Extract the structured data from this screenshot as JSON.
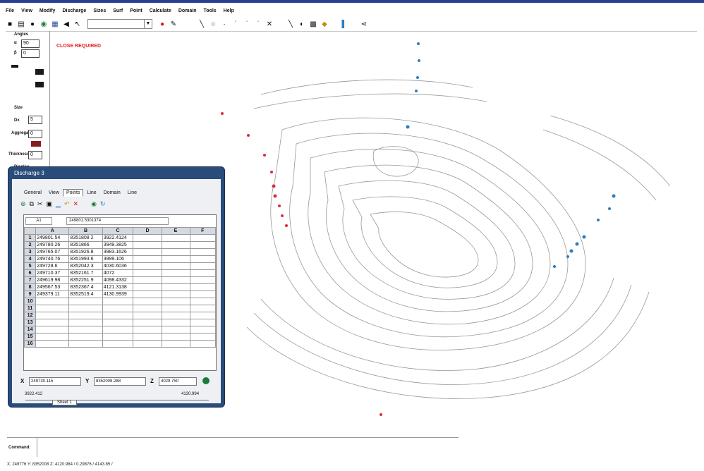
{
  "menu": [
    "File",
    "View",
    "Modify",
    "Discharge",
    "Sizes",
    "Surf",
    "Point",
    "Calculate",
    "Domain",
    "Tools",
    "Help"
  ],
  "toolbar": {
    "combo_value": ""
  },
  "left_panel": {
    "angles_label": "Angles",
    "a_value": "90",
    "b_value": "0",
    "size_label": "Size",
    "display_label": "Display",
    "dx_value": "5",
    "thickness_value": "0",
    "aggregate_value": "0"
  },
  "canvas": {
    "status_text": "CLOSE REQUIRED"
  },
  "dialog": {
    "title": "Discharge 3",
    "tabs": [
      "General",
      "View",
      "Points",
      "Line",
      "Domain",
      "Line"
    ],
    "active_tab": 2,
    "cell_ref": "A1",
    "formula": "249801.5301374",
    "columns": [
      "A",
      "B",
      "C",
      "D",
      "E",
      "F"
    ],
    "rows": [
      {
        "n": "1",
        "a": "249801.54",
        "b": "8351808 2",
        "c": "3922.4124"
      },
      {
        "n": "2",
        "a": "249780.26",
        "b": "8351866",
        "c": "3949.3825"
      },
      {
        "n": "3",
        "a": "249765.07",
        "b": "8351926.8",
        "c": "3983.1626"
      },
      {
        "n": "4",
        "a": "249740.76",
        "b": "8351993.6",
        "c": "3999.106"
      },
      {
        "n": "5",
        "a": "249728.6",
        "b": "8352042.3",
        "c": "4030.6036"
      },
      {
        "n": "6",
        "a": "249710.37",
        "b": "8352161.7",
        "c": "4072"
      },
      {
        "n": "7",
        "a": "249619.98",
        "b": "8352251.9",
        "c": "4098.4332"
      },
      {
        "n": "8",
        "a": "249567.53",
        "b": "8352367.4",
        "c": "4121.3138"
      },
      {
        "n": "9",
        "a": "249379.11",
        "b": "8352519.4",
        "c": "4130.9939"
      },
      {
        "n": "10",
        "a": "",
        "b": "",
        "c": ""
      },
      {
        "n": "11",
        "a": "",
        "b": "",
        "c": ""
      },
      {
        "n": "12",
        "a": "",
        "b": "",
        "c": ""
      },
      {
        "n": "13",
        "a": "",
        "b": "",
        "c": ""
      },
      {
        "n": "14",
        "a": "",
        "b": "",
        "c": ""
      },
      {
        "n": "15",
        "a": "",
        "b": "",
        "c": ""
      },
      {
        "n": "16",
        "a": "",
        "b": "",
        "c": ""
      }
    ],
    "sheet_tab": "Sheet 1",
    "x_label": "X",
    "x_value": "249730.115",
    "y_label": "Y",
    "y_value": "8352008.288",
    "z_label": "Z",
    "z_value": "4029.750",
    "left_footer": "3922.412",
    "right_footer": "4130.994"
  },
  "command": {
    "label": "Command:"
  },
  "statusbar": {
    "text": "X: 249776 Y: 8352008 Z: 4120.984 / 0.29876 / 4143.85 /"
  },
  "colors": {
    "accent": "#2a4c7a",
    "red_points": "#d63040",
    "blue_points": "#2a7fc0"
  }
}
